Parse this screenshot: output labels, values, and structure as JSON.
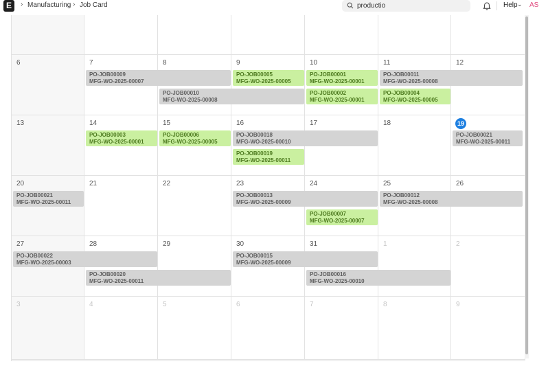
{
  "topbar": {
    "logo": "E",
    "breadcrumbs": [
      "Manufacturing",
      "Job Card"
    ],
    "search_value": "productio",
    "help_label": "Help",
    "avatar_initials": "AS"
  },
  "calendar": {
    "today": "19",
    "weeks": [
      [
        "",
        "",
        "",
        "",
        "",
        "",
        ""
      ],
      [
        "6",
        "7",
        "8",
        "9",
        "10",
        "11",
        "12"
      ],
      [
        "13",
        "14",
        "15",
        "16",
        "17",
        "18",
        "19"
      ],
      [
        "20",
        "21",
        "22",
        "23",
        "24",
        "25",
        "26"
      ],
      [
        "27",
        "28",
        "29",
        "30",
        "31",
        "1",
        "2"
      ],
      [
        "3",
        "4",
        "5",
        "6",
        "7",
        "8",
        "9"
      ]
    ],
    "events": [
      {
        "job": "PO-JOB00009",
        "wo": "MFG-WO-2025-00007",
        "color": "gray"
      },
      {
        "job": "PO-JOB00010",
        "wo": "MFG-WO-2025-00008",
        "color": "gray"
      },
      {
        "job": "PO-JOB00005",
        "wo": "MFG-WO-2025-00005",
        "color": "green"
      },
      {
        "job": "PO-JOB00001",
        "wo": "MFG-WO-2025-00001",
        "color": "green"
      },
      {
        "job": "PO-JOB00002",
        "wo": "MFG-WO-2025-00001",
        "color": "green"
      },
      {
        "job": "PO-JOB00011",
        "wo": "MFG-WO-2025-00008",
        "color": "gray"
      },
      {
        "job": "PO-JOB00004",
        "wo": "MFG-WO-2025-00005",
        "color": "green"
      },
      {
        "job": "PO-JOB00003",
        "wo": "MFG-WO-2025-00001",
        "color": "green"
      },
      {
        "job": "PO-JOB00006",
        "wo": "MFG-WO-2025-00005",
        "color": "green"
      },
      {
        "job": "PO-JOB00018",
        "wo": "MFG-WO-2025-00010",
        "color": "gray"
      },
      {
        "job": "PO-JOB00019",
        "wo": "MFG-WO-2025-00011",
        "color": "green"
      },
      {
        "job": "PO-JOB00021",
        "wo": "MFG-WO-2025-00011",
        "color": "gray"
      },
      {
        "job": "PO-JOB00021",
        "wo": "MFG-WO-2025-00011",
        "color": "gray"
      },
      {
        "job": "PO-JOB00013",
        "wo": "MFG-WO-2025-00009",
        "color": "gray"
      },
      {
        "job": "PO-JOB00012",
        "wo": "MFG-WO-2025-00008",
        "color": "gray"
      },
      {
        "job": "PO-JOB00007",
        "wo": "MFG-WO-2025-00007",
        "color": "green"
      },
      {
        "job": "PO-JOB00022",
        "wo": "MFG-WO-2025-00003",
        "color": "gray"
      },
      {
        "job": "PO-JOB00015",
        "wo": "MFG-WO-2025-00009",
        "color": "gray"
      },
      {
        "job": "PO-JOB00020",
        "wo": "MFG-WO-2025-00011",
        "color": "gray"
      },
      {
        "job": "PO-JOB00016",
        "wo": "MFG-WO-2025-00010",
        "color": "gray"
      }
    ]
  },
  "colors": {
    "gray_event": "#d4d4d4",
    "green_event": "#caf0a0",
    "today": "#1d7fe0",
    "avatar": "#e0457b"
  }
}
